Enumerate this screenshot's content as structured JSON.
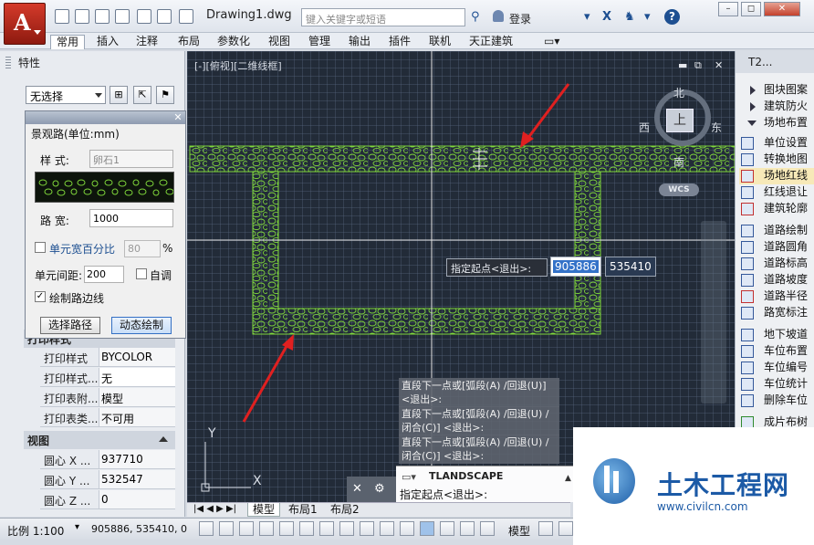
{
  "app": {
    "document_title": "Drawing1.dwg",
    "search_placeholder": "键入关键字或短语",
    "login_label": "登录",
    "help_label": "?"
  },
  "ribbon": {
    "tabs": [
      {
        "label": "常用",
        "active": true
      },
      {
        "label": "插入"
      },
      {
        "label": "注释"
      },
      {
        "label": "布局"
      },
      {
        "label": "参数化"
      },
      {
        "label": "视图"
      },
      {
        "label": "管理"
      },
      {
        "label": "输出"
      },
      {
        "label": "插件"
      },
      {
        "label": "联机"
      },
      {
        "label": "天正建筑"
      }
    ]
  },
  "properties": {
    "title": "特性",
    "selection": "无选择",
    "print_rows": [
      {
        "key": "打印样式",
        "value": "BYCOLOR"
      },
      {
        "key": "打印样式...",
        "value": "无"
      },
      {
        "key": "打印表附...",
        "value": "模型"
      },
      {
        "key": "打印表类...",
        "value": "不可用"
      }
    ],
    "view_section": "视图",
    "view_rows": [
      {
        "key": "圆心 X ...",
        "value": "937710"
      },
      {
        "key": "圆心 Y ...",
        "value": "532547"
      },
      {
        "key": "圆心 Z ...",
        "value": "0"
      }
    ],
    "print_section_partial": "打印样式"
  },
  "dialog": {
    "title": "景观路(单位:mm)",
    "style_label": "样  式:",
    "style_value": "卵石1",
    "width_label": "路  宽:",
    "width_value": "1000",
    "pct_label": "单元宽百分比",
    "pct_value": "80",
    "pct_unit": "%",
    "spacing_label": "单元间距:",
    "spacing_value": "200",
    "auto_label": "自调",
    "edge_label": "绘制路边线",
    "select_path_button": "选择路径",
    "dynamic_draw_button": "动态绘制"
  },
  "canvas": {
    "view_label": "[-][俯视][二维线框]",
    "compass": {
      "n": "北",
      "s": "南",
      "e": "东",
      "w": "西",
      "face": "上"
    },
    "wcs": "WCS",
    "dynamic_input": {
      "prompt": "指定起点<退出>:",
      "x": "905886",
      "y": "535410"
    },
    "history": [
      "直段下一点或[弧段(A) /回退(U)] <退出>:",
      "直段下一点或[弧段(A) /回退(U) /闭合(C)] <退出>:",
      "直段下一点或[弧段(A) /回退(U) /闭合(C)] <退出>:"
    ],
    "command_name": "TLANDSCAPE",
    "command_prompt": "指定起点<退出>:",
    "ucs_x": "X",
    "ucs_y": "Y"
  },
  "layout_tabs": [
    {
      "label": "模型",
      "active": true
    },
    {
      "label": "布局1"
    },
    {
      "label": "布局2"
    }
  ],
  "status": {
    "scale": "比例 1:100",
    "coords": "905886, 535410, 0",
    "model": "模型"
  },
  "tool_palette": {
    "title": "T2...",
    "items": [
      {
        "label": "图块图案",
        "type": "arrow"
      },
      {
        "label": "建筑防火",
        "type": "arrow"
      },
      {
        "label": "场地布置",
        "type": "arrow-down"
      },
      {
        "label": "单位设置"
      },
      {
        "label": "转换地图"
      },
      {
        "label": "场地红线",
        "highlight": true
      },
      {
        "label": "红线退让"
      },
      {
        "label": "建筑轮廓"
      },
      {
        "label": "道路绘制"
      },
      {
        "label": "道路圆角"
      },
      {
        "label": "道路标高"
      },
      {
        "label": "道路坡度"
      },
      {
        "label": "道路半径"
      },
      {
        "label": "路宽标注"
      },
      {
        "label": "地下坡道"
      },
      {
        "label": "车位布置"
      },
      {
        "label": "车位编号"
      },
      {
        "label": "车位统计"
      },
      {
        "label": "删除车位"
      },
      {
        "label": "成片布树"
      }
    ]
  },
  "watermark": {
    "name": "土木工程网",
    "url": "www.civilcn.com"
  },
  "colors": {
    "canvas_bg": "#222b38",
    "pebble_green": "#7fd63a",
    "accent_red": "#e02020"
  }
}
